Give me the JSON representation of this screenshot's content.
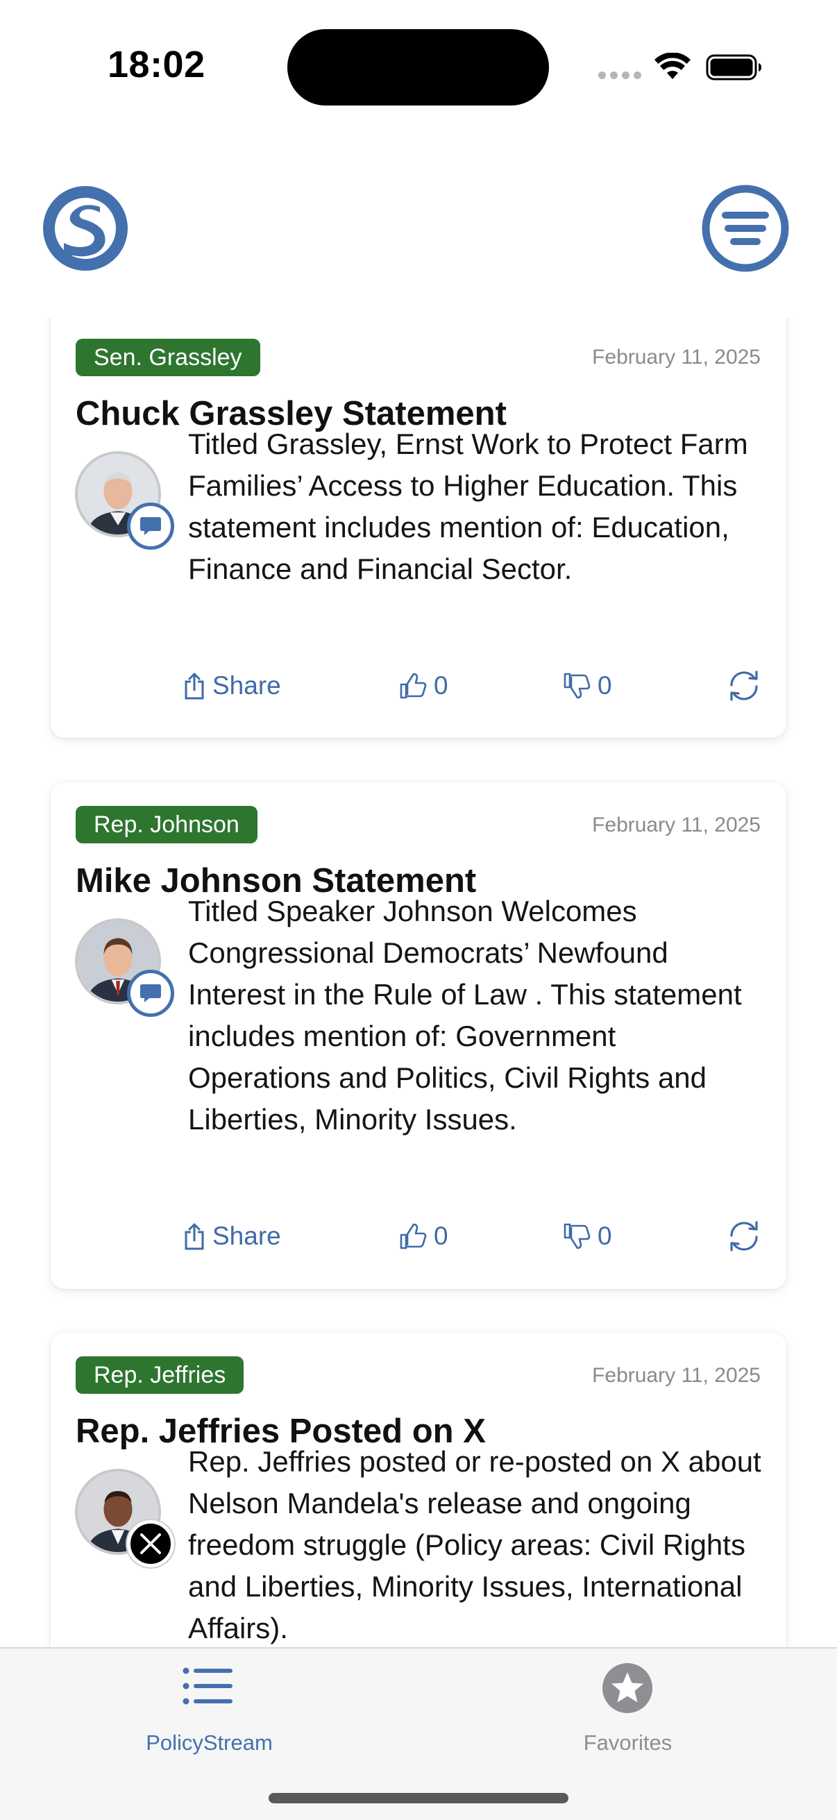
{
  "status_bar": {
    "time": "18:02"
  },
  "header": {
    "logo": "policystream-logo-icon",
    "menu": "filter-menu-icon"
  },
  "colors": {
    "accent": "#4470ad",
    "tag_green": "#2e7530",
    "date_gray": "#8a8a8a"
  },
  "feed": {
    "cards": [
      {
        "tag": "Sen. Grassley",
        "date": "February 11, 2025",
        "title": "Chuck Grassley Statement",
        "source_icon": "statement-bubble-icon",
        "body": "Titled Grassley, Ernst Work to Protect Farm Families’ Access to Higher Education.  This statement includes mention of: Education, Finance and Financial Sector.",
        "share_label": "Share",
        "likes": "0",
        "dislikes": "0"
      },
      {
        "tag": "Rep. Johnson",
        "date": "February 11, 2025",
        "title": "Mike Johnson Statement",
        "source_icon": "statement-bubble-icon",
        "body": "Titled Speaker Johnson Welcomes Congressional Democrats’ Newfound Interest in the Rule of Law .  This statement includes mention of: Government Operations and Politics, Civil Rights and Liberties, Minority Issues.",
        "share_label": "Share",
        "likes": "0",
        "dislikes": "0"
      },
      {
        "tag": "Rep. Jeffries",
        "date": "February 11, 2025",
        "title": "Rep. Jeffries Posted on X",
        "source_icon": "x-logo-icon",
        "body": "Rep. Jeffries posted or re-posted on X about Nelson Mandela's release and ongoing freedom struggle (Policy areas: Civil Rights and Liberties, Minority Issues, International Affairs)."
      }
    ]
  },
  "tabbar": {
    "tabs": [
      {
        "label": "PolicyStream",
        "icon": "list-icon",
        "active": true
      },
      {
        "label": "Favorites",
        "icon": "star-icon",
        "active": false
      }
    ]
  }
}
